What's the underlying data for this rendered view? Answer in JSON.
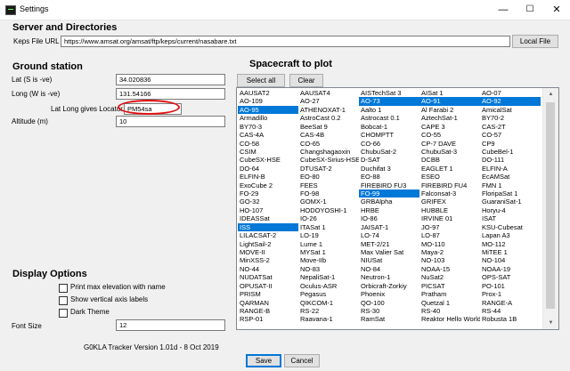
{
  "window": {
    "title": "Settings",
    "icons": [
      "app-icon",
      "minimize-icon",
      "maximize-icon",
      "close-icon"
    ]
  },
  "server": {
    "heading": "Server and Directories",
    "keps_label": "Keps File URL",
    "keps_value": "https://www.amsat.org/amsat/ftp/keps/current/nasabare.txt",
    "local_file_button": "Local File"
  },
  "ground": {
    "heading": "Ground station",
    "lat_label": "Lat (S is -ve)",
    "lat_value": "34.020836",
    "long_label": "Long (W is -ve)",
    "long_value": "131.54166",
    "locator_label": "Lat Long gives Locator",
    "locator_value": "PM54sa",
    "alt_label": "Altitude (m)",
    "alt_value": "10"
  },
  "spacecraft": {
    "heading": "Spacecraft to plot",
    "select_all_button": "Select all",
    "clear_button": "Clear",
    "items": [
      {
        "name": "AAUSAT2"
      },
      {
        "name": "AAUSAT4"
      },
      {
        "name": "AISTechSat 3"
      },
      {
        "name": "AISat 1"
      },
      {
        "name": "AO-07"
      },
      {
        "name": "AO-109"
      },
      {
        "name": "AO-27"
      },
      {
        "name": "AO-73",
        "selected": true
      },
      {
        "name": "AO-91",
        "selected": true
      },
      {
        "name": "AO-92",
        "selected": true
      },
      {
        "name": "AO-95",
        "selected": true
      },
      {
        "name": "ATHENOXAT-1"
      },
      {
        "name": "Aalto 1"
      },
      {
        "name": "Al Farabi 2"
      },
      {
        "name": "AmicalSat"
      },
      {
        "name": "Armadillo"
      },
      {
        "name": "AstroCast 0.2"
      },
      {
        "name": "Astrocast 0.1"
      },
      {
        "name": "AztechSat-1"
      },
      {
        "name": "BY70-2"
      },
      {
        "name": "BY70-3"
      },
      {
        "name": "BeeSat 9"
      },
      {
        "name": "Bobcat-1"
      },
      {
        "name": "CAPE 3"
      },
      {
        "name": "CAS-2T"
      },
      {
        "name": "CAS-4A"
      },
      {
        "name": "CAS-4B"
      },
      {
        "name": "CHOMPTT"
      },
      {
        "name": "CO-55"
      },
      {
        "name": "CO-57"
      },
      {
        "name": "CO-58"
      },
      {
        "name": "CO-65"
      },
      {
        "name": "CO-66"
      },
      {
        "name": "CP-7 DAVE"
      },
      {
        "name": "CP9"
      },
      {
        "name": "CSIM"
      },
      {
        "name": "Changshagaoxin"
      },
      {
        "name": "ChubuSat-2"
      },
      {
        "name": "ChubuSat-3"
      },
      {
        "name": "CubeBel-1"
      },
      {
        "name": "CubeSX-HSE"
      },
      {
        "name": "CubeSX-Sirius-HSE"
      },
      {
        "name": "D-SAT"
      },
      {
        "name": "DCBB"
      },
      {
        "name": "DO-111"
      },
      {
        "name": "DO-64"
      },
      {
        "name": "DTUSAT-2"
      },
      {
        "name": "Duchifat 3"
      },
      {
        "name": "EAGLET 1"
      },
      {
        "name": "ELFIN-A"
      },
      {
        "name": "ELFIN-B"
      },
      {
        "name": "EO-80"
      },
      {
        "name": "EO-88"
      },
      {
        "name": "ESEO"
      },
      {
        "name": "EcAMSat"
      },
      {
        "name": "ExoCube 2"
      },
      {
        "name": "FEES"
      },
      {
        "name": "FIREBIRD FU3"
      },
      {
        "name": "FIREBIRD FU4"
      },
      {
        "name": "FMN 1"
      },
      {
        "name": "FO-29"
      },
      {
        "name": "FO-98"
      },
      {
        "name": "FO-99",
        "selected": true
      },
      {
        "name": "Falconsat-3"
      },
      {
        "name": "FloripaSat 1"
      },
      {
        "name": "GO-32"
      },
      {
        "name": "GOMX-1"
      },
      {
        "name": "GRBAlpha"
      },
      {
        "name": "GRIFEX"
      },
      {
        "name": "GuaraniSat-1"
      },
      {
        "name": "HO-107"
      },
      {
        "name": "HODOYOSHI-1"
      },
      {
        "name": "HRBE"
      },
      {
        "name": "HUBBLE"
      },
      {
        "name": "Horyu-4"
      },
      {
        "name": "IDEASSat"
      },
      {
        "name": "IO-26"
      },
      {
        "name": "IO-86"
      },
      {
        "name": "IRVINE 01"
      },
      {
        "name": "ISAT"
      },
      {
        "name": "ISS",
        "selected": true
      },
      {
        "name": "ITASat 1"
      },
      {
        "name": "JAISAT-1"
      },
      {
        "name": "JO-97"
      },
      {
        "name": "KSU-Cubesat"
      },
      {
        "name": "LILACSAT-2"
      },
      {
        "name": "LO-19"
      },
      {
        "name": "LO-74"
      },
      {
        "name": "LO-87"
      },
      {
        "name": "Lapan A3"
      },
      {
        "name": "LightSail-2"
      },
      {
        "name": "Lume 1"
      },
      {
        "name": "MET-2/21"
      },
      {
        "name": "MO-110"
      },
      {
        "name": "MO-112"
      },
      {
        "name": "MOVE-II"
      },
      {
        "name": "MYSat 1"
      },
      {
        "name": "Max Valier Sat"
      },
      {
        "name": "Maya-2"
      },
      {
        "name": "MiTEE 1"
      },
      {
        "name": "MinXSS-2"
      },
      {
        "name": "Move-IIb"
      },
      {
        "name": "NIUSat"
      },
      {
        "name": "NO-103"
      },
      {
        "name": "NO-104"
      },
      {
        "name": "NO-44"
      },
      {
        "name": "NO-83"
      },
      {
        "name": "NO-84"
      },
      {
        "name": "NOAA-15"
      },
      {
        "name": "NOAA-19"
      },
      {
        "name": "NUDATSat"
      },
      {
        "name": "NepaliSat-1"
      },
      {
        "name": "Neutron-1"
      },
      {
        "name": "NuSat2"
      },
      {
        "name": "OPS-SAT"
      },
      {
        "name": "OPUSAT-II"
      },
      {
        "name": "Oculus-ASR"
      },
      {
        "name": "Orbicraft-Zorkiy"
      },
      {
        "name": "PICSAT"
      },
      {
        "name": "PO-101"
      },
      {
        "name": "PRISM"
      },
      {
        "name": "Pegasus"
      },
      {
        "name": "Phoenix"
      },
      {
        "name": "Pratham"
      },
      {
        "name": "Prox-1"
      },
      {
        "name": "QARMAN"
      },
      {
        "name": "QIKCOM-1"
      },
      {
        "name": "QO-100"
      },
      {
        "name": "Quetzal 1"
      },
      {
        "name": "RANGE-A"
      },
      {
        "name": "RANGE-B"
      },
      {
        "name": "RS-22"
      },
      {
        "name": "RS-30"
      },
      {
        "name": "RS-40"
      },
      {
        "name": "RS-44"
      },
      {
        "name": "RSP-01"
      },
      {
        "name": "Raavana-1"
      },
      {
        "name": "RamSat"
      },
      {
        "name": "Reaktor Hello World"
      },
      {
        "name": "Robusta 1B"
      }
    ]
  },
  "display": {
    "heading": "Display Options",
    "print_max_label": "Print max elevation with name",
    "show_vertical_label": "Show vertical axis labels",
    "dark_theme_label": "Dark Theme",
    "font_size_label": "Font Size",
    "font_size_value": "12"
  },
  "footer": {
    "version": "G0KLA Tracker Version 1.01d - 8 Oct 2019",
    "save_button": "Save",
    "cancel_button": "Cancel"
  }
}
